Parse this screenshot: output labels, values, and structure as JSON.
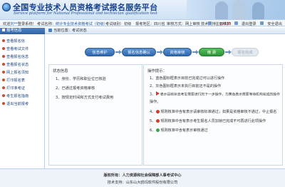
{
  "header": {
    "title": "全国专业技术人员资格考试报名服务平台",
    "subtitle": "Service platform for National Professional and technician qualification test"
  },
  "infobar": {
    "welcome": "欢迎",
    "user": "刘**",
    "welcome_tail": "登录系统！",
    "notice_label": "考试名称：",
    "notice_value": "统计专业技术资格考试（初级）",
    "exam_level": "考试级别：初级",
    "region": "报考地区：四川省",
    "status": "审核方式：网上审核",
    "support_label": "技术支持：",
    "support_value": "12333",
    "links": [
      "注册维护",
      "退出登录",
      "安全退出"
    ]
  },
  "sidebar": {
    "header": "报考信息",
    "items": [
      {
        "label": "查看报名信"
      },
      {
        "label": "查看考试文件"
      },
      {
        "label": "查看报名信息"
      },
      {
        "label": "查看报名状态"
      },
      {
        "label": "网上报名须知"
      },
      {
        "label": "打印报名表"
      },
      {
        "label": "打印准考证"
      },
      {
        "label": "考生报名指南"
      },
      {
        "label": "退出当前报考"
      }
    ]
  },
  "breadcrumb": {
    "location": "当前位置：",
    "page": "考试状态"
  },
  "steps": [
    {
      "label": "信息维护",
      "state": "done"
    },
    {
      "label": "报名信息确认",
      "state": "done"
    },
    {
      "label": "资格审核",
      "state": "done"
    },
    {
      "label": "缴 费",
      "state": "current"
    },
    {
      "label": "报名完成",
      "state": "todo"
    }
  ],
  "status_panel": {
    "title": "状态信息",
    "items": [
      "1、身份、学历和职业位已核验",
      "2、已通过报考资格审核",
      "3、按规定时间和方式支付考试费用"
    ]
  },
  "help_panel": {
    "title": "操作提示：",
    "items": [
      {
        "num": "1、",
        "icon": "",
        "text": "蓝色图标框表示目前已完成过可以进行操作"
      },
      {
        "num": "2、",
        "icon": "",
        "text": "灰色图标框表示未执行目前还不是的操作"
      },
      {
        "num": "3、",
        "icon": "play",
        "text": "表示目前状态考生需要进行的下一步操作，为黄色表示需要等待机构完成的操作"
      },
      {
        "num": "",
        "icon": "",
        "text": "操作。"
      },
      {
        "num": "4、",
        "icon": "red",
        "text": "规则核准中含有表示请审核标准通过；如果是资格审核不通过，中止报名"
      },
      {
        "num": "5、",
        "icon": "red",
        "text": "规则核准中含有表示考生报名人员加锁已完成不可再进行此项操作"
      },
      {
        "num": "6、",
        "icon": "green",
        "text": "规则核准中含有表示审核通过"
      }
    ]
  },
  "footer": {
    "line1_label": "版权所有：",
    "line1_value": "人力资源和社会保障部人事考试中心",
    "line2_label": "技术支持：",
    "line2_value": "山东山大鸥玛软件股份有限公司"
  }
}
